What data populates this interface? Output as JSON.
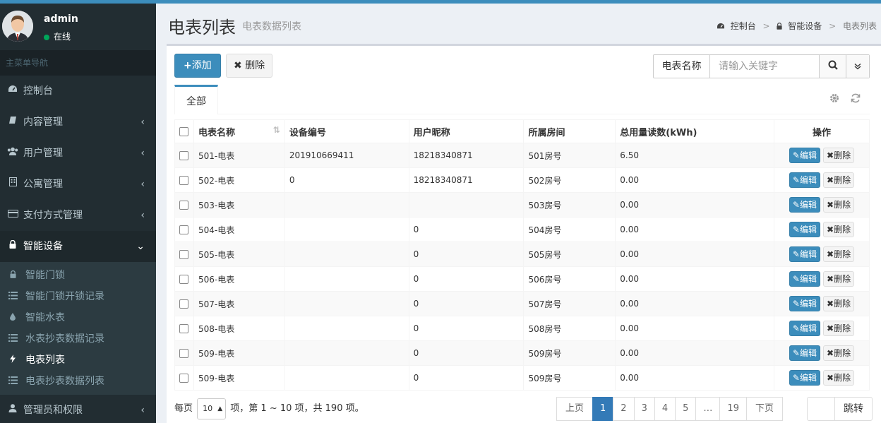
{
  "colors": {
    "accent": "#3c8dbc",
    "sidebar_bg": "#222d32",
    "status_online": "#00a65a"
  },
  "user": {
    "name": "admin",
    "status": "在线"
  },
  "sidebar": {
    "nav_header": "主菜单导航",
    "items": [
      {
        "label": "控制台",
        "icon": "dashboard-icon"
      },
      {
        "label": "内容管理",
        "icon": "book-icon"
      },
      {
        "label": "用户管理",
        "icon": "users-icon"
      },
      {
        "label": "公寓管理",
        "icon": "building-icon"
      },
      {
        "label": "支付方式管理",
        "icon": "credit-card-icon"
      },
      {
        "label": "智能设备",
        "icon": "lock-icon"
      }
    ],
    "subitems": [
      {
        "label": "智能门锁",
        "icon": "lock-icon"
      },
      {
        "label": "智能门锁开锁记录",
        "icon": "list-icon"
      },
      {
        "label": "智能水表",
        "icon": "tint-icon"
      },
      {
        "label": "水表抄表数据记录",
        "icon": "list-icon"
      },
      {
        "label": "电表列表",
        "icon": "bolt-icon"
      },
      {
        "label": "电表抄表数据列表",
        "icon": "list-icon"
      }
    ],
    "last_item": {
      "label": "管理员和权限",
      "icon": "user-icon"
    }
  },
  "header": {
    "title": "电表列表",
    "subtitle": "电表数据列表"
  },
  "breadcrumb": [
    "控制台",
    "智能设备",
    "电表列表"
  ],
  "toolbar": {
    "add_label": "添加",
    "delete_label": "删除"
  },
  "search": {
    "label": "电表名称",
    "placeholder": "请输入关键字"
  },
  "tabs": [
    "全部"
  ],
  "table": {
    "columns": [
      "电表名称",
      "设备编号",
      "用户昵称",
      "所属房间",
      "总用量读数(kWh)",
      "操作"
    ],
    "edit_label": "编辑",
    "delete_label": "删除",
    "rows": [
      [
        "501-电表",
        "201910669411",
        "18218340871",
        "501房号",
        "6.50"
      ],
      [
        "502-电表",
        "0",
        "18218340871",
        "502房号",
        "0.00"
      ],
      [
        "503-电表",
        "",
        "",
        "503房号",
        "0.00"
      ],
      [
        "504-电表",
        "",
        "0",
        "504房号",
        "0.00"
      ],
      [
        "505-电表",
        "",
        "0",
        "505房号",
        "0.00"
      ],
      [
        "506-电表",
        "",
        "0",
        "506房号",
        "0.00"
      ],
      [
        "507-电表",
        "",
        "0",
        "507房号",
        "0.00"
      ],
      [
        "508-电表",
        "",
        "0",
        "508房号",
        "0.00"
      ],
      [
        "509-电表",
        "",
        "0",
        "509房号",
        "0.00"
      ],
      [
        "509-电表",
        "",
        "0",
        "509房号",
        "0.00"
      ]
    ]
  },
  "footer": {
    "per_page_prefix": "每页",
    "page_size": "10",
    "summary": "项，第 1 ~ 10 项，共 190 项。",
    "pages": [
      "上页",
      "1",
      "2",
      "3",
      "4",
      "5",
      "…",
      "19",
      "下页"
    ],
    "current_page": "1",
    "jump_label": "跳转"
  }
}
